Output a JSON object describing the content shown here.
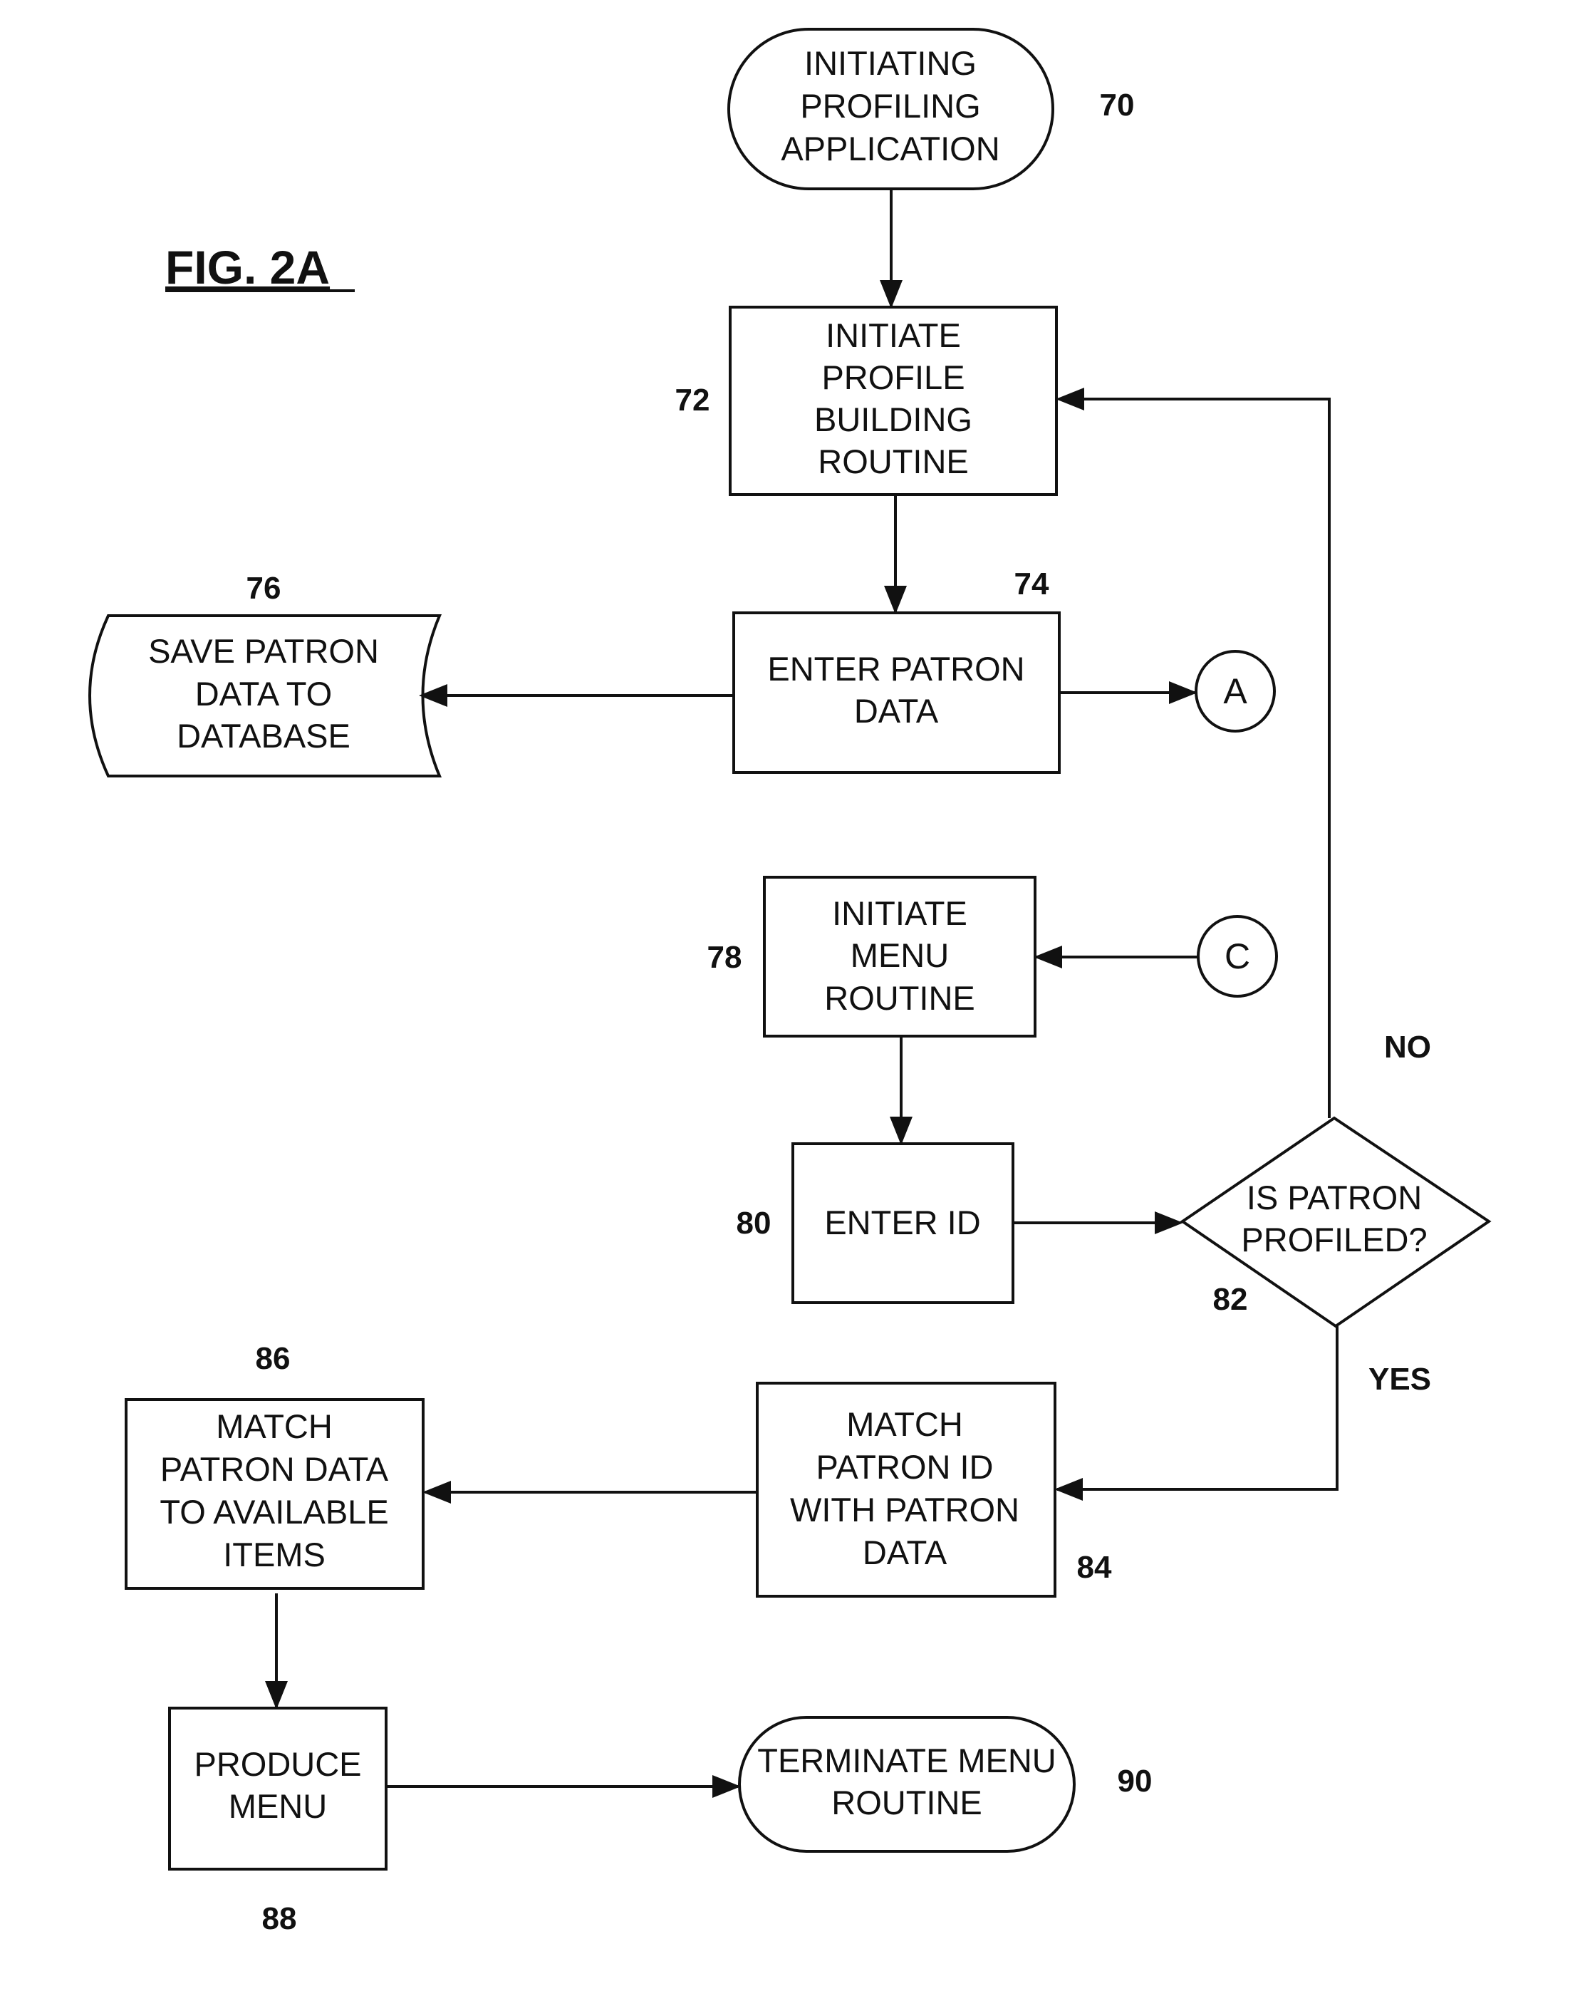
{
  "figure": {
    "title": "FIG. 2A"
  },
  "nodes": {
    "n70": {
      "ref": "70",
      "lines": [
        "INITIATING",
        "PROFILING",
        "APPLICATION"
      ]
    },
    "n72": {
      "ref": "72",
      "lines": [
        "INITIATE",
        "PROFILE",
        "BUILDING",
        "ROUTINE"
      ]
    },
    "n74": {
      "ref": "74",
      "lines": [
        "ENTER PATRON",
        "DATA"
      ]
    },
    "n76": {
      "ref": "76",
      "lines": [
        "SAVE PATRON",
        "DATA TO",
        "DATABASE"
      ]
    },
    "n78": {
      "ref": "78",
      "lines": [
        "INITIATE",
        "MENU",
        "ROUTINE"
      ]
    },
    "n80": {
      "ref": "80",
      "lines": [
        "ENTER ID"
      ]
    },
    "n82": {
      "ref": "82",
      "lines": [
        "IS PATRON",
        "PROFILED?"
      ]
    },
    "n84": {
      "ref": "84",
      "lines": [
        "MATCH",
        "PATRON ID",
        "WITH PATRON",
        "DATA"
      ]
    },
    "n86": {
      "ref": "86",
      "lines": [
        "MATCH",
        "PATRON DATA",
        "TO AVAILABLE",
        "ITEMS"
      ]
    },
    "n88": {
      "ref": "88",
      "lines": [
        "PRODUCE",
        "MENU"
      ]
    },
    "n90": {
      "ref": "90",
      "lines": [
        "TERMINATE MENU",
        "ROUTINE"
      ]
    }
  },
  "connectors": {
    "a": "A",
    "c": "C"
  },
  "branches": {
    "no": "NO",
    "yes": "YES"
  }
}
